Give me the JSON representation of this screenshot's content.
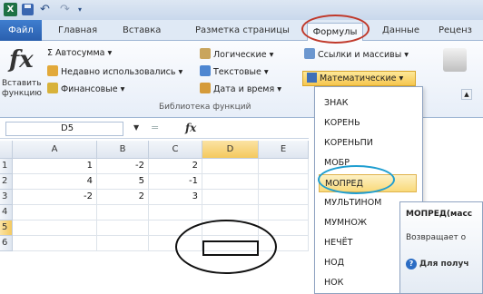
{
  "qat": {
    "logo": "X",
    "undo": "↶",
    "redo": "↷",
    "custom": "▾"
  },
  "tabs": {
    "file": "Файл",
    "home": "Главная",
    "insert": "Вставка",
    "layout": "Разметка страницы",
    "formulas": "Формулы",
    "data": "Данные",
    "review": "Реценз"
  },
  "ribbon": {
    "insert_function": "Вставить функцию",
    "fx": "fx",
    "autosum": "Σ Автосумма ▾",
    "recent": "Недавно использовались ▾",
    "financial": "Финансовые ▾",
    "logical": "Логические ▾",
    "text": "Текстовые ▾",
    "datetime": "Дата и время ▾",
    "links": "Ссылки и массивы ▾",
    "math": "Математические ▾",
    "group_label": "Библиотека функций"
  },
  "formula_bar": {
    "name_box": "D5",
    "fx": "fx",
    "cancel": "="
  },
  "grid": {
    "columns": [
      "A",
      "B",
      "C",
      "D",
      "E"
    ],
    "rows": [
      "1",
      "2",
      "3",
      "4",
      "5",
      "6"
    ],
    "cells": [
      [
        "1",
        "-2",
        "2",
        "",
        ""
      ],
      [
        "4",
        "5",
        "-1",
        "",
        ""
      ],
      [
        "-2",
        "2",
        "3",
        "",
        ""
      ],
      [
        "",
        "",
        "",
        "",
        ""
      ],
      [
        "",
        "",
        "",
        "",
        ""
      ],
      [
        "",
        "",
        "",
        "",
        ""
      ]
    ],
    "selected_cell": "D5"
  },
  "menu": {
    "items": [
      "ЗНАК",
      "КОРЕНЬ",
      "КОРЕНЬПИ",
      "МОБР",
      "МОПРЕД",
      "МУЛЬТИНОМ",
      "МУМНОЖ",
      "НЕЧЁТ",
      "НОД",
      "НОК"
    ],
    "highlighted": "МОПРЕД"
  },
  "tooltip": {
    "title": "МОПРЕД(масс",
    "desc": "Возвращает о",
    "help": "Для получ"
  },
  "colors": {
    "accent": "#2a5fae",
    "highlight": "#f9d97a",
    "red_mark": "#c0392b",
    "blue_mark": "#1f9ed0"
  }
}
